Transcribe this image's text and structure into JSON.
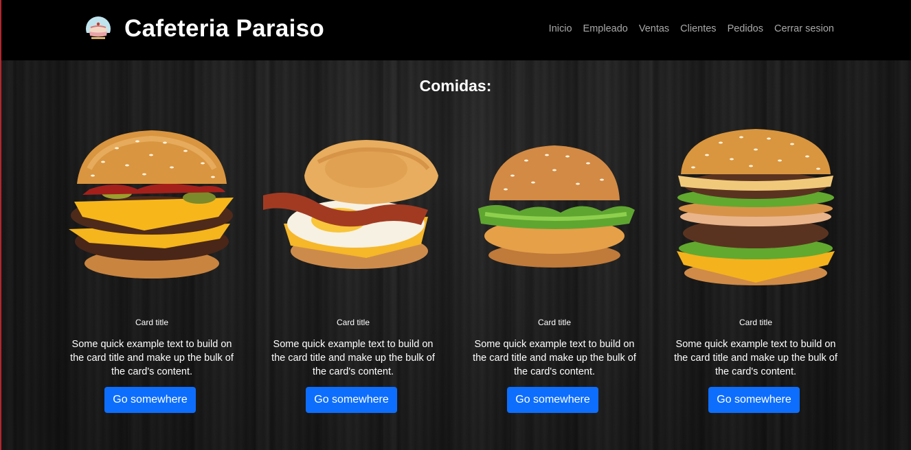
{
  "header": {
    "brand": "Cafeteria Paraiso",
    "logo_icon": "cake-logo-icon",
    "nav": [
      {
        "label": "Inicio"
      },
      {
        "label": "Empleado"
      },
      {
        "label": "Ventas"
      },
      {
        "label": "Clientes"
      },
      {
        "label": "Pedidos"
      },
      {
        "label": "Cerrar sesion"
      }
    ]
  },
  "main": {
    "heading": "Comidas:",
    "cards": [
      {
        "image": "double-cheeseburger-image",
        "title": "Card title",
        "text": "Some quick example text to build on the card title and make up the bulk of the card's content.",
        "button": "Go somewhere"
      },
      {
        "image": "bacon-egg-muffin-image",
        "title": "Card title",
        "text": "Some quick example text to build on the card title and make up the bulk of the card's content.",
        "button": "Go somewhere"
      },
      {
        "image": "chicken-burger-image",
        "title": "Card title",
        "text": "Some quick example text to build on the card title and make up the bulk of the card's content.",
        "button": "Go somewhere"
      },
      {
        "image": "big-burger-image",
        "title": "Card title",
        "text": "Some quick example text to build on the card title and make up the bulk of the card's content.",
        "button": "Go somewhere"
      }
    ]
  },
  "colors": {
    "navbar": "#000000",
    "button": "#0d6efd",
    "nav_link": "#a9a9a9",
    "text": "#ffffff"
  }
}
